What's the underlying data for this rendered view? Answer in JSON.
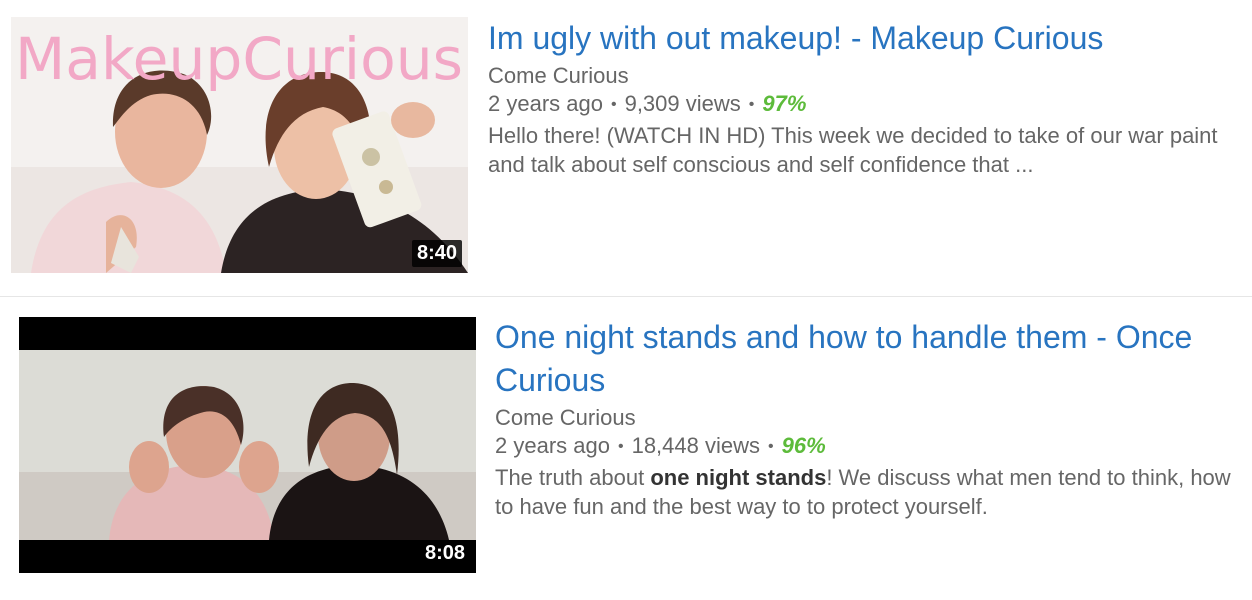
{
  "results": [
    {
      "title": "Im ugly with out makeup! - Makeup Curious",
      "thumbnail_overlay_text": "MakeupCurious",
      "duration": "8:40",
      "channel": "Come Curious",
      "age": "2 years ago",
      "views": "9,309 views",
      "rating": "97%",
      "description": "Hello there! (WATCH IN HD) This week we decided to take of our war paint and talk about self conscious and self confidence that ..."
    },
    {
      "title": "One night stands and how to handle them - Once Curious",
      "duration": "8:08",
      "channel": "Come Curious",
      "age": "2 years ago",
      "views": "18,448 views",
      "rating": "96%",
      "description_before": "The truth about ",
      "description_bold": "one night stands",
      "description_after": "! We discuss what men tend to think, how to have fun and the best way to to protect yourself."
    }
  ],
  "colors": {
    "title_link": "#2874c0",
    "rating": "#5dbb3b",
    "meta_text": "#666666",
    "logo_pink": "#f2a8c6"
  },
  "separator": "•"
}
